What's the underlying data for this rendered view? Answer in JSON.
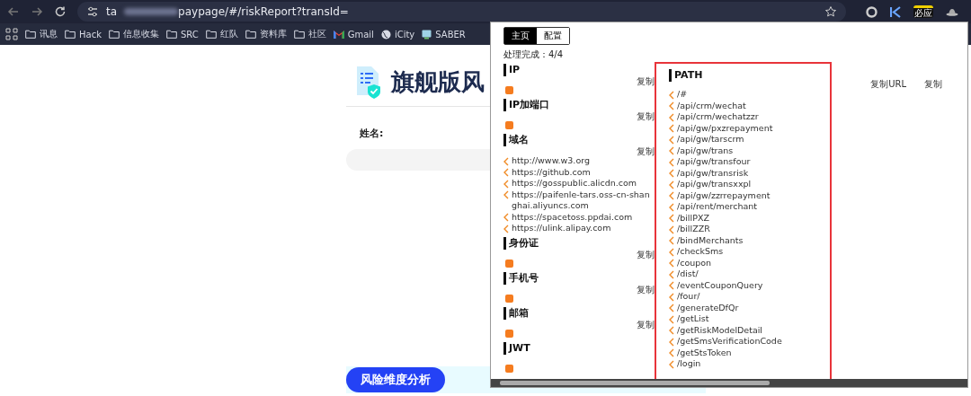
{
  "browser": {
    "url_start": "ta",
    "url_end": "paypage/#/riskReport?transId=",
    "bookmarks": [
      {
        "label": "讯息",
        "kind": "folder"
      },
      {
        "label": "Hack",
        "kind": "folder"
      },
      {
        "label": "信息收集",
        "kind": "folder"
      },
      {
        "label": "SRC",
        "kind": "folder"
      },
      {
        "label": "红队",
        "kind": "folder"
      },
      {
        "label": "资料库",
        "kind": "folder"
      },
      {
        "label": "社区",
        "kind": "folder"
      },
      {
        "label": "Gmail",
        "kind": "gmail"
      },
      {
        "label": "iCity",
        "kind": "globe"
      },
      {
        "label": "SABER",
        "kind": "app"
      }
    ],
    "extensions": [
      {
        "kind": "ring"
      },
      {
        "kind": "k"
      },
      {
        "kind": "badge",
        "badge": "必应"
      },
      {
        "kind": "hat"
      }
    ]
  },
  "page": {
    "title": "旗舰版风",
    "name_label": "姓名:",
    "analysis_button": "风险维度分析"
  },
  "popup": {
    "tabs": [
      {
        "label": "主页",
        "selected": true
      },
      {
        "label": "配置",
        "selected": false
      }
    ],
    "status": "处理完成：4/4",
    "sections": [
      {
        "title": "IP",
        "copy": "复制",
        "items": [
          {
            "kind": "empty"
          }
        ]
      },
      {
        "title": "IP加端口",
        "copy": "复制",
        "items": [
          {
            "kind": "empty"
          }
        ]
      },
      {
        "title": "域名",
        "copy": "复制",
        "items": [
          {
            "kind": "link",
            "text": "http://www.w3.org"
          },
          {
            "kind": "link",
            "text": "https://github.com"
          },
          {
            "kind": "link",
            "text": "https://gosspublic.alicdn.com"
          },
          {
            "kind": "link",
            "text": "https://paifenle-tars.oss-cn-shanghai.aliyuncs.com"
          },
          {
            "kind": "link",
            "text": "https://spacetoss.ppdai.com"
          },
          {
            "kind": "link",
            "text": "https://ulink.alipay.com"
          }
        ]
      },
      {
        "title": "身份证",
        "copy": "复制",
        "items": [
          {
            "kind": "empty"
          }
        ]
      },
      {
        "title": "手机号",
        "copy": "复制",
        "items": [
          {
            "kind": "empty"
          }
        ]
      },
      {
        "title": "邮箱",
        "copy": "复制",
        "items": [
          {
            "kind": "empty"
          }
        ]
      },
      {
        "title": "JWT",
        "items": [
          {
            "kind": "empty"
          }
        ]
      }
    ],
    "path": {
      "title": "PATH",
      "copy_url": "复制URL",
      "copy": "复制",
      "items": [
        "/#",
        "/api/crm/wechat",
        "/api/crm/wechatzzr",
        "/api/gw/pxzrepayment",
        "/api/gw/tarscrm",
        "/api/gw/trans",
        "/api/gw/transfour",
        "/api/gw/transrisk",
        "/api/gw/transxxpl",
        "/api/gw/zzrrepayment",
        "/api/rent/merchant",
        "/billPXZ",
        "/billZZR",
        "/bindMerchants",
        "/checkSms",
        "/coupon",
        "/dist/",
        "/eventCouponQuery",
        "/four/",
        "/generateDfQr",
        "/getList",
        "/getRiskModelDetail",
        "/getSmsVerificationCode",
        "/getStsToken",
        "/login"
      ]
    }
  }
}
